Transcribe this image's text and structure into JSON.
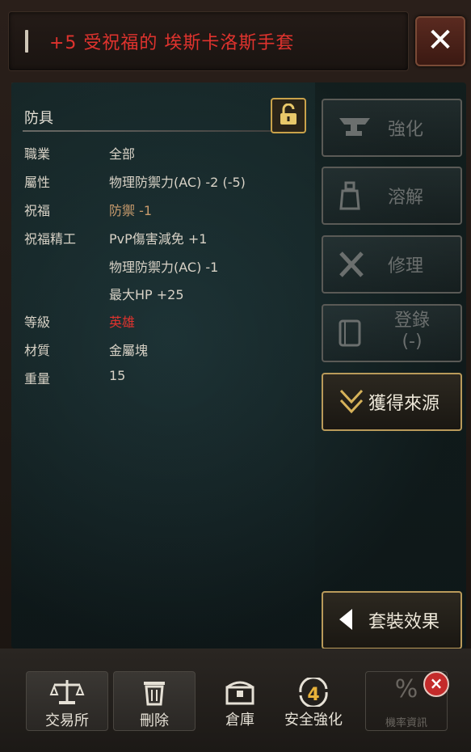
{
  "item": {
    "name": "+5 受祝福的 埃斯卡洛斯手套",
    "category": "防具"
  },
  "properties": [
    {
      "label": "職業",
      "value": "全部"
    },
    {
      "label": "屬性",
      "value": "物理防禦力(AC) -2 (-5)"
    },
    {
      "label": "祝福",
      "value": "防禦 -1"
    },
    {
      "label": "祝福精工",
      "value": "PvP傷害減免 +1"
    },
    {
      "label": "",
      "value": "物理防禦力(AC) -1"
    },
    {
      "label": "",
      "value": "最大HP +25"
    },
    {
      "label": "等級",
      "value": "英雄"
    },
    {
      "label": "材質",
      "value": "金屬塊"
    },
    {
      "label": "重量",
      "value": "15"
    }
  ],
  "side_buttons": {
    "enhance": "強化",
    "dissolve": "溶解",
    "repair": "修理",
    "register": "登錄",
    "register_sub": "(-)",
    "source": "獲得來源",
    "set_effect": "套裝效果"
  },
  "bottom_buttons": {
    "trade": "交易所",
    "delete": "刪除",
    "warehouse": "倉庫",
    "safe_enhance": "安全強化",
    "safe_enhance_badge": "4",
    "probability": "機率資訊"
  },
  "colors": {
    "title_red": "#e0332e",
    "bless_brown": "#c79a6c",
    "grade_hero": "#e0332e",
    "active_border": "#b99a5a"
  }
}
